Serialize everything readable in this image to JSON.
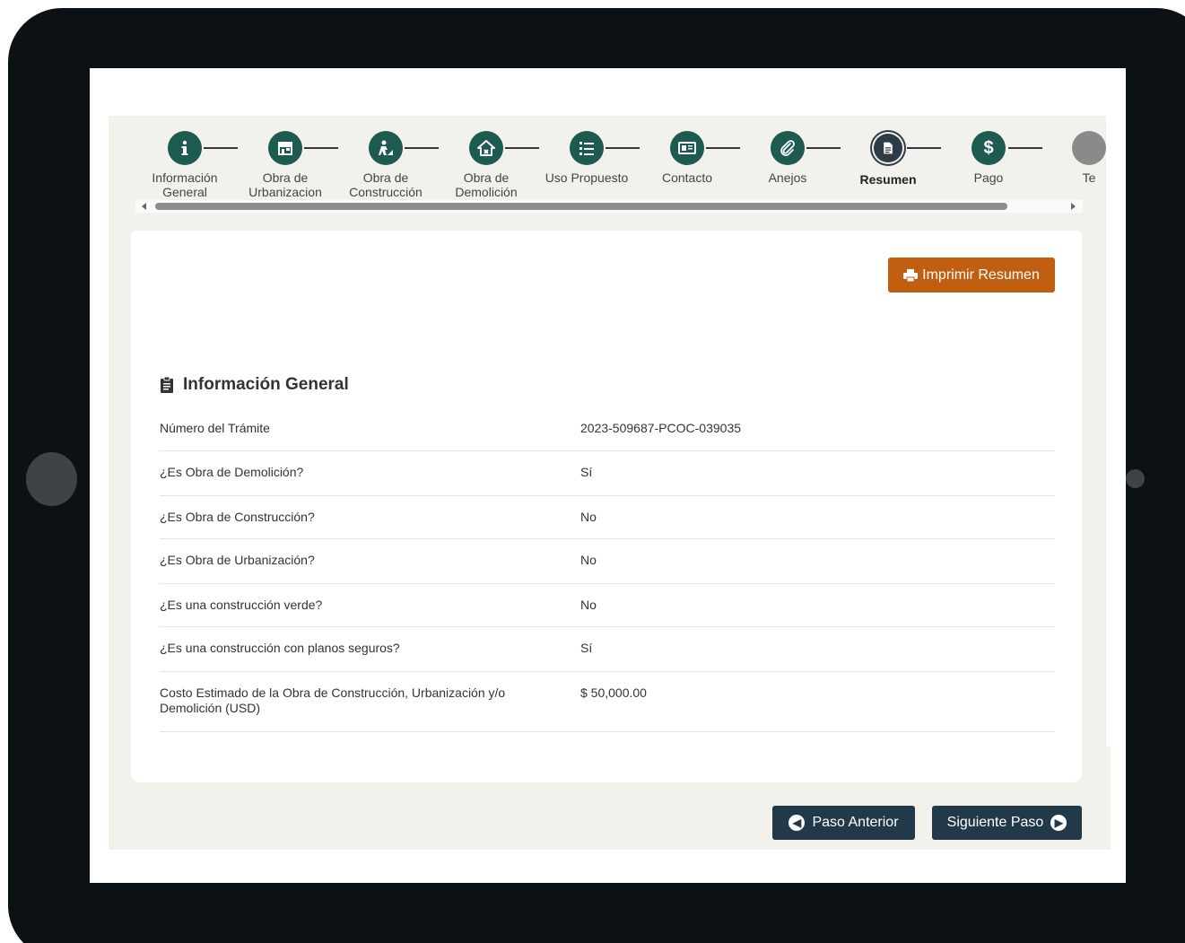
{
  "stepper": {
    "steps": [
      {
        "label": "Información General",
        "icon": "info-icon"
      },
      {
        "label": "Obra de Urbanizacion",
        "icon": "storefront-icon"
      },
      {
        "label": "Obra de Construcción",
        "icon": "worker-icon"
      },
      {
        "label": "Obra de Demolición",
        "icon": "house-icon"
      },
      {
        "label": "Uso Propuesto",
        "icon": "checklist-icon"
      },
      {
        "label": "Contacto",
        "icon": "id-card-icon"
      },
      {
        "label": "Anejos",
        "icon": "paperclip-icon"
      },
      {
        "label": "Resumen",
        "icon": "document-icon"
      },
      {
        "label": "Pago",
        "icon": "dollar-icon"
      },
      {
        "label": "Te",
        "icon": "circle-icon"
      }
    ],
    "current": "Resumen"
  },
  "actions": {
    "print_label": "Imprimir Resumen",
    "prev_label": "Paso Anterior",
    "next_label": "Siguiente Paso"
  },
  "section": {
    "title": "Información General",
    "rows": [
      {
        "label": "Número del Trámite",
        "value": "2023-509687-PCOC-039035"
      },
      {
        "label": "¿Es Obra de Demolición?",
        "value": "Sí"
      },
      {
        "label": "¿Es Obra de Construcción?",
        "value": "No"
      },
      {
        "label": "¿Es Obra de Urbanización?",
        "value": "No"
      },
      {
        "label": "¿Es una construcción verde?",
        "value": "No"
      },
      {
        "label": "¿Es una construcción con planos seguros?",
        "value": "Sí"
      },
      {
        "label": "Costo Estimado de la Obra de Construcción, Urbanización y/o Demolición (USD)",
        "value": "$ 50,000.00"
      }
    ]
  },
  "colors": {
    "step_done": "#1d5a4f",
    "step_current": "#2e3a45",
    "print_button": "#c05f12",
    "nav_button": "#22394a"
  }
}
